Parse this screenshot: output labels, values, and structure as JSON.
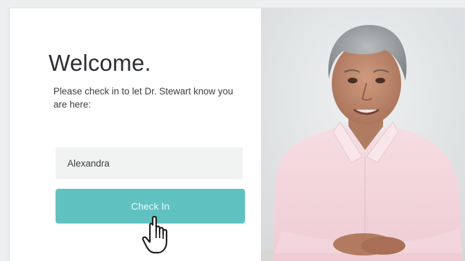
{
  "welcome": {
    "title": "Welcome.",
    "message": "Please check in to let Dr. Stewart know you are here:"
  },
  "form": {
    "name_value": "Alexandra",
    "checkin_label": "Check In"
  },
  "icons": {
    "cursor": "hand-pointer-icon"
  },
  "colors": {
    "accent": "#5fc2c1",
    "field_bg": "#f1f3f2",
    "title_text": "#2c2f33"
  }
}
